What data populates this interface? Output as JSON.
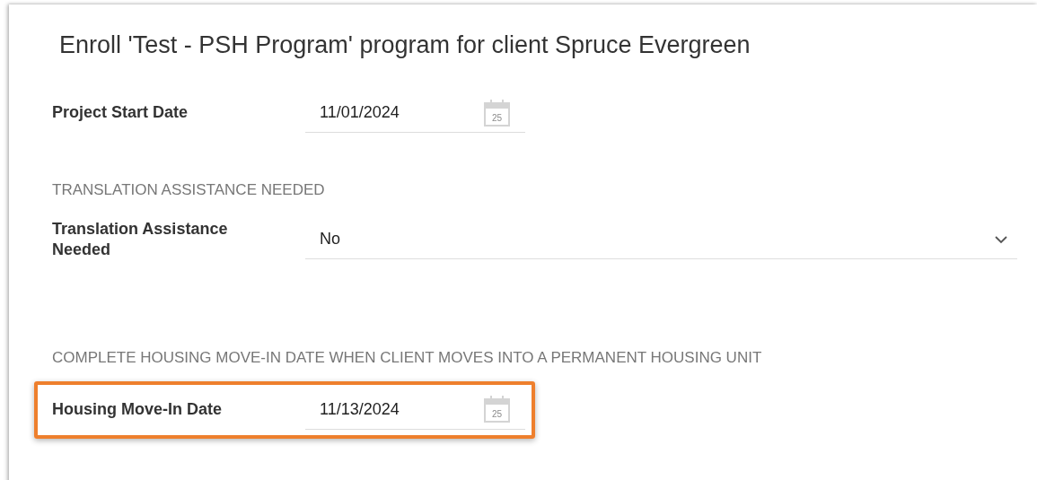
{
  "title": "Enroll 'Test - PSH Program' program for client Spruce Evergreen",
  "items": [
    {
      "kind": "date",
      "label": "Project Start Date",
      "value": "11/01/2024",
      "calendar_day": "25",
      "highlighted": false
    },
    {
      "kind": "heading",
      "text": "TRANSLATION ASSISTANCE NEEDED"
    },
    {
      "kind": "select",
      "label": "Translation Assistance Needed",
      "value": "No",
      "highlighted": false
    },
    {
      "kind": "heading",
      "text": "COMPLETE HOUSING MOVE-IN DATE WHEN CLIENT MOVES INTO A PERMANENT HOUSING UNIT"
    },
    {
      "kind": "date",
      "label": "Housing Move-In Date",
      "value": "11/13/2024",
      "calendar_day": "25",
      "highlighted": true
    }
  ]
}
